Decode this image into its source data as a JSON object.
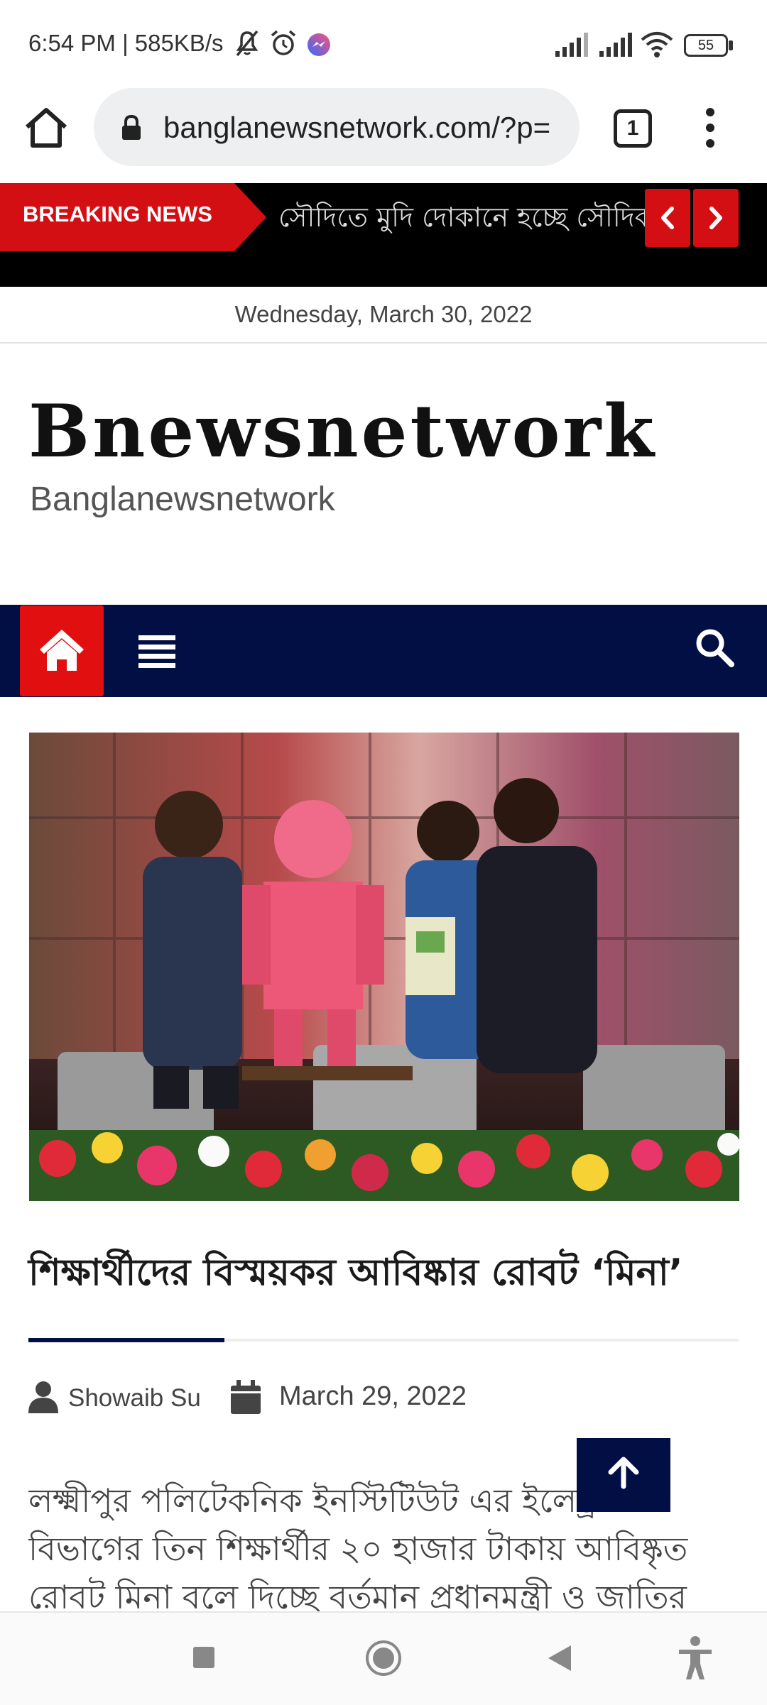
{
  "status_bar": {
    "time_speed": "6:54 PM | 585KB/s",
    "battery": "55"
  },
  "browser": {
    "url": "banglanewsnetwork.com/?p=",
    "tab_count": "1"
  },
  "breaking": {
    "label": "BREAKING NEWS",
    "ticker": "সৌদিতে মুদি দোকানে হচ্ছে সৌদিকরণ"
  },
  "date_bar": "Wednesday, March 30, 2022",
  "site": {
    "title": "Bnewsnetwork",
    "tagline": "Banglanewsnetwork"
  },
  "article": {
    "headline": "শিক্ষার্থীদের বিস্ময়কর আবিষ্কার রোবট ‘মিনা’",
    "author": "Showaib Su",
    "date": "March 29, 2022",
    "body": "লক্ষ্মীপুর পলিটেকনিক ইনস্টিটিউট এর ইলেক্ট্রনিক্স বিভাগের তিন শিক্ষার্থীর ২০ হাজার টাকায় আবিষ্কৃত রোবট মিনা বলে দিচ্ছে বর্তমান প্রধানমন্ত্রী ও জাতির"
  },
  "colors": {
    "brand_red": "#d40f14",
    "nav_navy": "#020f45"
  }
}
